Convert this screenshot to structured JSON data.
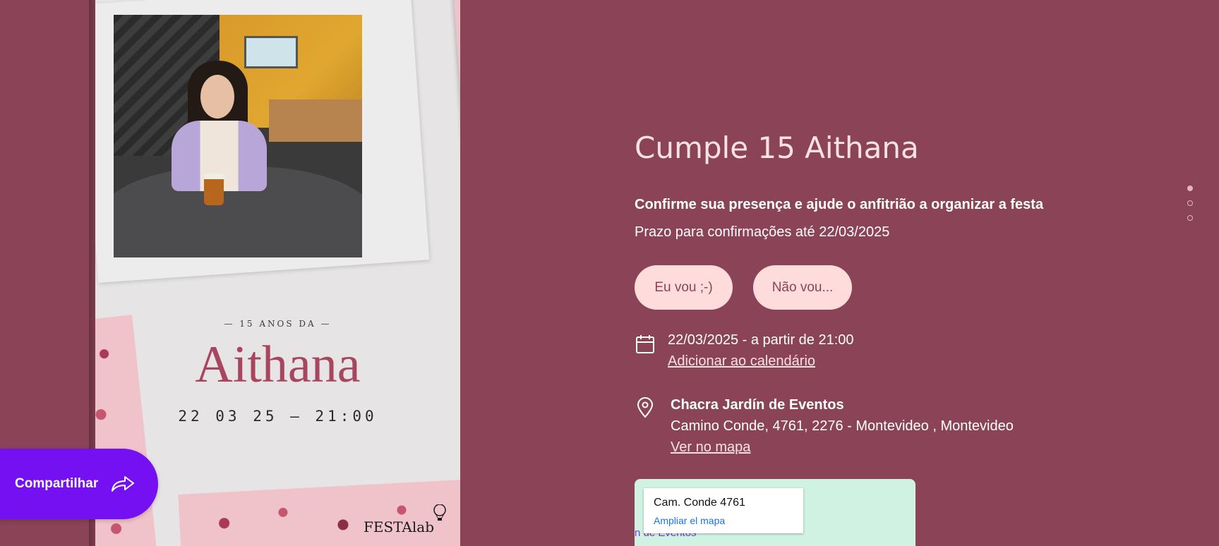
{
  "invitation_card": {
    "subtitle": "— 15 ANOS DA —",
    "name": "Aithana",
    "date_time": "22 03 25 — 21:00",
    "brand": "FESTAlab"
  },
  "share_button": {
    "label": "Compartilhar",
    "icon": "share-arrow-icon"
  },
  "event": {
    "title": "Cumple 15 Aithana",
    "rsvp_prompt": "Confirme sua presença e ajude o anfitrião a organizar a festa",
    "deadline": "Prazo para confirmações até 22/03/2025",
    "rsvp_yes": "Eu vou ;-)",
    "rsvp_no": "Não vou...",
    "date_line": "22/03/2025 - a partir de 21:00",
    "add_calendar": "Adicionar ao calendário",
    "venue_name": "Chacra Jardín de Eventos",
    "venue_address": "Camino Conde, 4761, 2276 - Montevideo , Montevideo",
    "see_map": "Ver no mapa"
  },
  "map": {
    "address": "Cam. Conde 4761",
    "enlarge_link": "Ampliar el mapa",
    "place_label": "n de Eventos"
  },
  "section_nav": {
    "count": 3,
    "active_index": 0
  },
  "colors": {
    "background": "#8a4357",
    "accent_purple": "#7410f2",
    "button_pink": "#ffdcdc",
    "title_pink": "#fde2e2"
  }
}
